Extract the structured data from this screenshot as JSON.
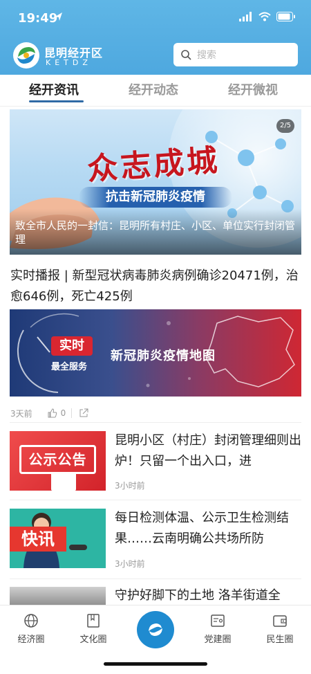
{
  "status_bar": {
    "time": "19:49"
  },
  "header": {
    "brand_cn": "昆明经开区",
    "brand_en": "KETDZ",
    "search_placeholder": "搜索",
    "icons": [
      "location-arrow-icon",
      "signal-icon",
      "wifi-icon",
      "battery-icon",
      "logo-icon",
      "search-icon"
    ]
  },
  "tabs": [
    {
      "label": "经开资讯",
      "active": true
    },
    {
      "label": "经开动态",
      "active": false
    },
    {
      "label": "经开微视",
      "active": false
    }
  ],
  "hero": {
    "banner_title": "众志成城",
    "banner_subtitle": "抗击新冠肺炎疫情",
    "caption": "致全市人民的一封信：昆明所有村庄、小区、单位实行封闭管理",
    "counter": "2/5"
  },
  "feature": {
    "title": "实时播报 | 新型冠状病毒肺炎病例确诊20471例，治愈646例，死亡425例",
    "banner_tag": "实时",
    "banner_tag_sub": "最全服务",
    "banner_title": "新冠肺炎疫情地图",
    "time": "3天前",
    "likes": "0"
  },
  "articles": [
    {
      "title": "昆明小区（村庄）封闭管理细则出炉！只留一个出入口，进",
      "time": "3小时前",
      "thumb_text": "公示公告"
    },
    {
      "title": "每日检测体温、公示卫生检测结果……云南明确公共场所防",
      "time": "3小时前",
      "thumb_text": "快讯"
    },
    {
      "title": "守护好脚下的土地 洛羊街道全",
      "time": "",
      "thumb_text": ""
    }
  ],
  "bottom_nav": [
    {
      "label": "经济圈",
      "icon": "globe-icon"
    },
    {
      "label": "文化圈",
      "icon": "book-icon"
    },
    {
      "label": "",
      "icon": "home-logo-icon"
    },
    {
      "label": "党建圈",
      "icon": "id-card-icon"
    },
    {
      "label": "民生圈",
      "icon": "wallet-icon"
    }
  ],
  "colors": {
    "header_blue": "#4ea8df",
    "accent": "#2f6aa5",
    "red": "#c7161e"
  }
}
